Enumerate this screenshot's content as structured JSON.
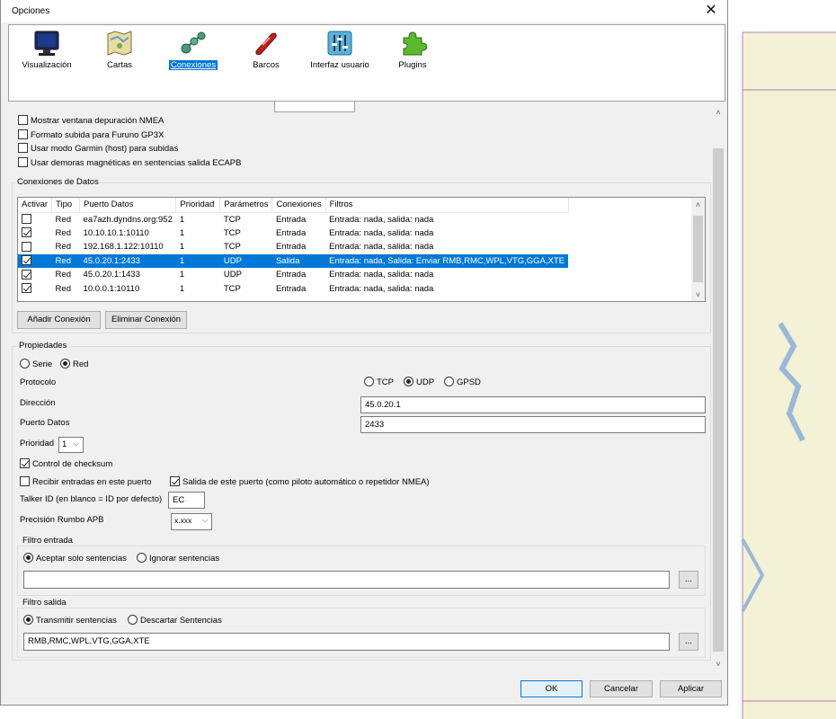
{
  "window": {
    "title": "Opciones",
    "close_glyph": "✕"
  },
  "toolbar": {
    "items": [
      {
        "label": "Visualización",
        "icon": "monitor-icon"
      },
      {
        "label": "Cartas",
        "icon": "map-icon"
      },
      {
        "label": "Conexiones",
        "icon": "connections-icon",
        "active": true
      },
      {
        "label": "Barcos",
        "icon": "ship-icon"
      },
      {
        "label": "Interfaz usuario",
        "icon": "sliders-icon"
      },
      {
        "label": "Plugins",
        "icon": "puzzle-icon"
      }
    ]
  },
  "nmea_options": [
    {
      "label": "Mostrar ventana depuración NMEA",
      "checked": false
    },
    {
      "label": "Formato subida para Furuno GP3X",
      "checked": false
    },
    {
      "label": "Usar modo Garmin (host) para subidas",
      "checked": false
    },
    {
      "label": "Usar demoras magnéticas en sentencias salida ECAPB",
      "checked": false
    }
  ],
  "connections": {
    "title": "Conexiones de Datos",
    "columns": [
      "Activar",
      "Tipo",
      "Puerto Datos",
      "Prioridad",
      "Parámetros",
      "Conexiones",
      "Filtros"
    ],
    "rows": [
      {
        "active": false,
        "type": "Red",
        "port": "ea7azh.dyndns.org:952",
        "priority": "1",
        "params": "TCP",
        "direction": "Entrada",
        "filters": "Entrada: nada, salida: nada",
        "selected": false
      },
      {
        "active": true,
        "type": "Red",
        "port": "10.10.10.1:10110",
        "priority": "1",
        "params": "TCP",
        "direction": "Entrada",
        "filters": "Entrada: nada, salida: nada",
        "selected": false
      },
      {
        "active": false,
        "type": "Red",
        "port": "192.168.1.122:10110",
        "priority": "1",
        "params": "TCP",
        "direction": "Entrada",
        "filters": "Entrada: nada, salida: nada",
        "selected": false
      },
      {
        "active": true,
        "type": "Red",
        "port": "45.0.20.1:2433",
        "priority": "1",
        "params": "UDP",
        "direction": "Salida",
        "filters": "Entrada: nada, Salida: Enviar RMB,RMC,WPL,VTG,GGA,XTE",
        "selected": true
      },
      {
        "active": true,
        "type": "Red",
        "port": "45.0.20.1:1433",
        "priority": "1",
        "params": "UDP",
        "direction": "Entrada",
        "filters": "Entrada: nada, salida: nada",
        "selected": false
      },
      {
        "active": true,
        "type": "Red",
        "port": "10.0.0.1:10110",
        "priority": "1",
        "params": "TCP",
        "direction": "Entrada",
        "filters": "Entrada: nada, salida: nada",
        "selected": false
      }
    ],
    "add_label": "Añadir Conexión",
    "remove_label": "Eliminar Conexión"
  },
  "properties": {
    "title": "Propiedades",
    "serial_label": "Serie",
    "network_label": "Red",
    "protocol_label": "Protocolo",
    "tcp_label": "TCP",
    "udp_label": "UDP",
    "gpsd_label": "GPSD",
    "address_label": "Dirección",
    "address_value": "45.0.20.1",
    "port_label": "Puerto Datos",
    "port_value": "2433",
    "priority_label": "Prioridad",
    "priority_value": "1",
    "checksum_label": "Control de checksum",
    "receive_label": "Recibir entradas en este puerto",
    "output_label": "Salida de este puerto (como piloto automático o repetidor NMEA)",
    "talker_label": "Talker ID (en blanco = ID por defecto)",
    "talker_value": "EC",
    "apb_label": "Precisión Rumbo APB",
    "apb_value": "x.xxx"
  },
  "input_filter": {
    "title": "Filtro entrada",
    "accept_label": "Aceptar solo sentencias",
    "ignore_label": "Ignorar sentencias",
    "value": "",
    "browse_label": "..."
  },
  "output_filter": {
    "title": "Filtro salida",
    "transmit_label": "Transmitir sentencias",
    "discard_label": "Descartar Sentencias",
    "value": "RMB,RMC,WPL,VTG,GGA,XTE",
    "browse_label": "..."
  },
  "footer": {
    "ok_label": "OK",
    "cancel_label": "Cancelar",
    "apply_label": "Aplicar"
  }
}
